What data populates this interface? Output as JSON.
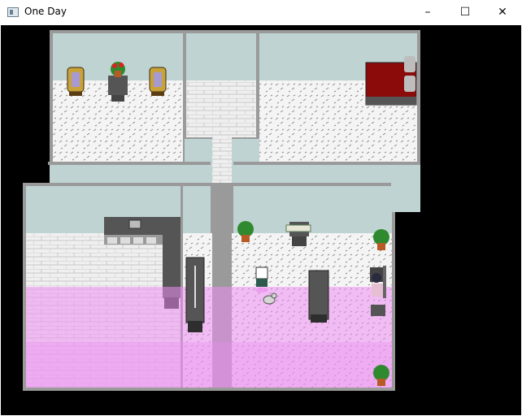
{
  "window": {
    "title": "One Day",
    "controls": {
      "minimize": "–",
      "maximize": "☐",
      "close": "✕"
    }
  },
  "scene": {
    "icons": [
      "window-app-icon",
      "minimize-icon",
      "maximize-icon",
      "close-icon"
    ],
    "colors": {
      "wall": "#bfd3d3",
      "floor": "#f3f3f3",
      "wall_trim": "#8a8a8a",
      "counter": "#555555",
      "bed_red": "#8b0a0a",
      "armchair": "#c8a23a",
      "highlight_pink": "#ee8ef2",
      "background": "#000000"
    }
  }
}
